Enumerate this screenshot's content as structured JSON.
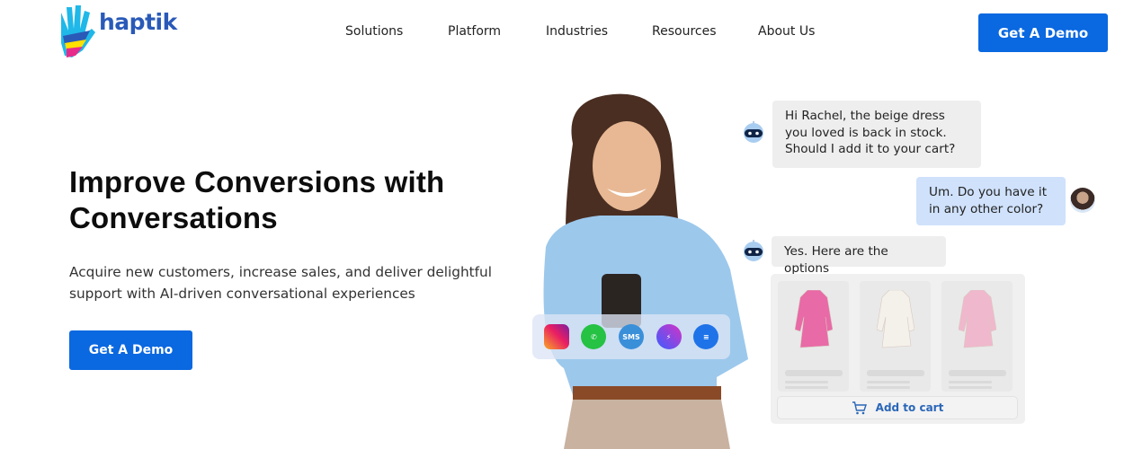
{
  "header": {
    "logo_text": "haptik",
    "nav": [
      "Solutions",
      "Platform",
      "Industries",
      "Resources",
      "About Us"
    ],
    "cta_label": "Get A Demo"
  },
  "hero": {
    "title": "Improve Conversions with Conversations",
    "subtitle": "Acquire new customers, increase sales, and deliver delightful support with AI-driven conversational experiences",
    "cta_label": "Get A Demo"
  },
  "channels": [
    {
      "name": "instagram-icon",
      "label": ""
    },
    {
      "name": "whatsapp-icon",
      "label": "✆"
    },
    {
      "name": "sms-icon",
      "label": "SMS"
    },
    {
      "name": "messenger-icon",
      "label": "⚡"
    },
    {
      "name": "chat-icon",
      "label": "≡"
    }
  ],
  "chat": {
    "messages": [
      {
        "sender": "bot",
        "text": "Hi Rachel, the beige dress you loved is back in stock. Should I add it to your cart?"
      },
      {
        "sender": "user",
        "text": "Um. Do you have it in any other color?"
      },
      {
        "sender": "bot",
        "text": "Yes. Here are the options"
      }
    ],
    "products": [
      {
        "color": "#e86aa6"
      },
      {
        "color": "#f4f1ea"
      },
      {
        "color": "#f0b8cc"
      }
    ],
    "add_to_cart_label": "Add to cart"
  },
  "colors": {
    "brand_blue": "#0a68e0",
    "logo_blue": "#2a5ab8",
    "bot_bubble": "#eeeeee",
    "user_bubble": "#cfe1fb"
  }
}
